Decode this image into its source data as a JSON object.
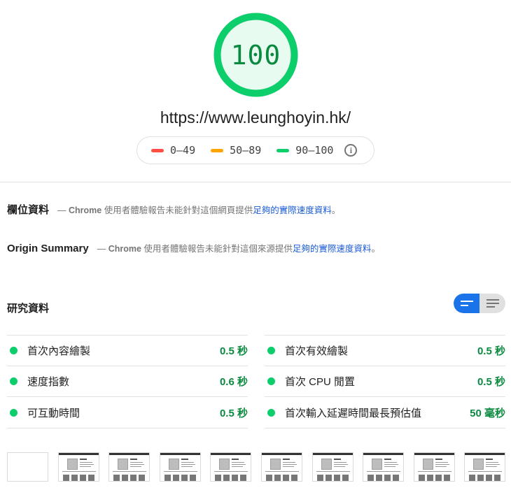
{
  "score": {
    "value": "100",
    "fraction": 1.0,
    "ring_color": "#0cce6b",
    "fill_color": "#e8fbf0",
    "text_color": "#0a8a3f"
  },
  "url": "https://www.leunghoyin.hk/",
  "legend": [
    {
      "label": "0–49",
      "color": "#ff4e42"
    },
    {
      "label": "50–89",
      "color": "#ffa400"
    },
    {
      "label": "90–100",
      "color": "#0cce6b"
    }
  ],
  "field_data": {
    "title": "欄位資料",
    "dash": "—",
    "chrome": "Chrome",
    "desc": "使用者體驗報告未能針對這個網頁提供",
    "link": "足夠的實際速度資料",
    "end": "。"
  },
  "origin_summary": {
    "title": "Origin Summary",
    "dash": "—",
    "chrome": "Chrome",
    "desc": "使用者體驗報告未能針對這個來源提供",
    "link": "足夠的實際速度資料",
    "end": "。"
  },
  "lab_data": {
    "title": "研究資料",
    "metrics_left": [
      {
        "label": "首次內容繪製",
        "value": "0.5 秒"
      },
      {
        "label": "速度指數",
        "value": "0.6 秒"
      },
      {
        "label": "可互動時間",
        "value": "0.5 秒"
      }
    ],
    "metrics_right": [
      {
        "label": "首次有效繪製",
        "value": "0.5 秒"
      },
      {
        "label": "首次 CPU 閒置",
        "value": "0.5 秒"
      },
      {
        "label": "首次輸入延遲時間最長預估值",
        "value": "50 毫秒"
      }
    ]
  },
  "filmstrip_count": 10,
  "accent_color": "#1a73e8"
}
